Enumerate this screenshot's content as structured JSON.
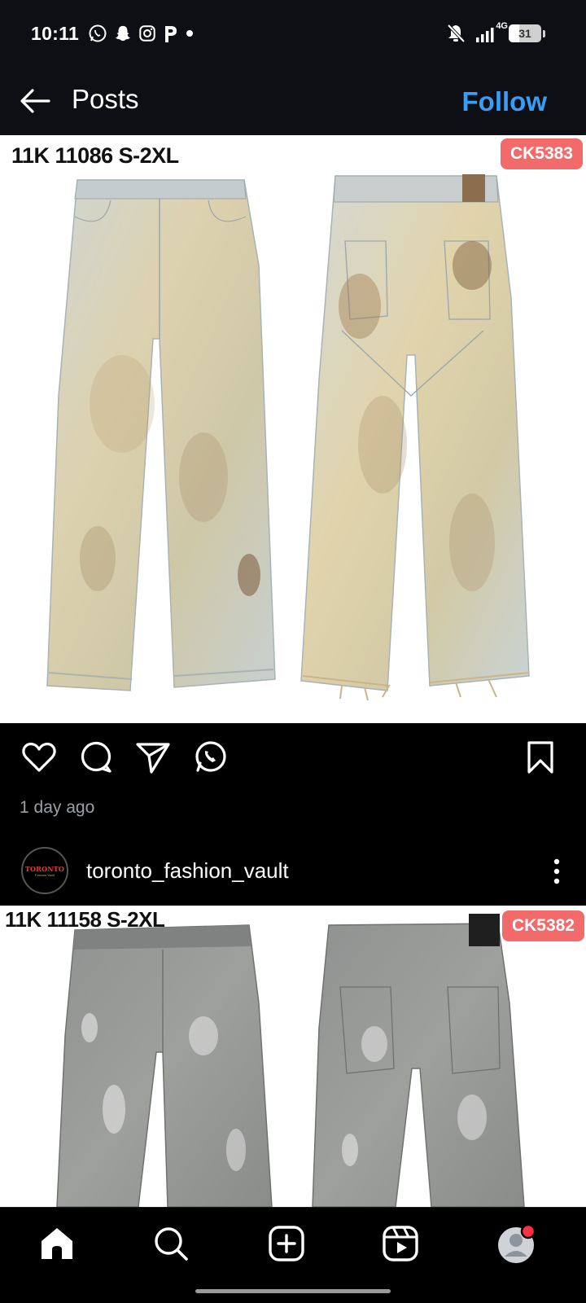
{
  "status_bar": {
    "time": "10:11",
    "network": "4G",
    "battery": "31",
    "left_icons": [
      "whatsapp-icon",
      "snapchat-icon",
      "instagram-icon",
      "pinterest-icon",
      "dot-icon"
    ],
    "right_icons": [
      "bell-off-icon",
      "signal-icon",
      "battery-icon"
    ]
  },
  "header": {
    "title": "Posts",
    "follow_label": "Follow",
    "accent": "#3b9cf4"
  },
  "post1": {
    "caption_code": "11K 11086 S-2XL",
    "tag": "CK5383",
    "tag_color": "#f26a6a",
    "image": "light-wash distressed jeans front and back",
    "time_ago": "1 day ago"
  },
  "actions": {
    "icons": [
      "heart-icon",
      "comment-icon",
      "share-icon",
      "whatsapp-icon",
      "bookmark-icon"
    ]
  },
  "profile": {
    "username": "toronto_fashion_vault",
    "avatar_text": "TORONTO",
    "avatar_sub": "Fashion Vault"
  },
  "post2": {
    "caption_code": "11K 11158 S-2XL",
    "tag": "CK5382",
    "image": "grey paint-splatter jeans front and back"
  },
  "bottom_nav": {
    "items": [
      "home-icon",
      "search-icon",
      "create-icon",
      "reels-icon",
      "profile-icon"
    ],
    "notification_dot_color": "#ff3040"
  }
}
